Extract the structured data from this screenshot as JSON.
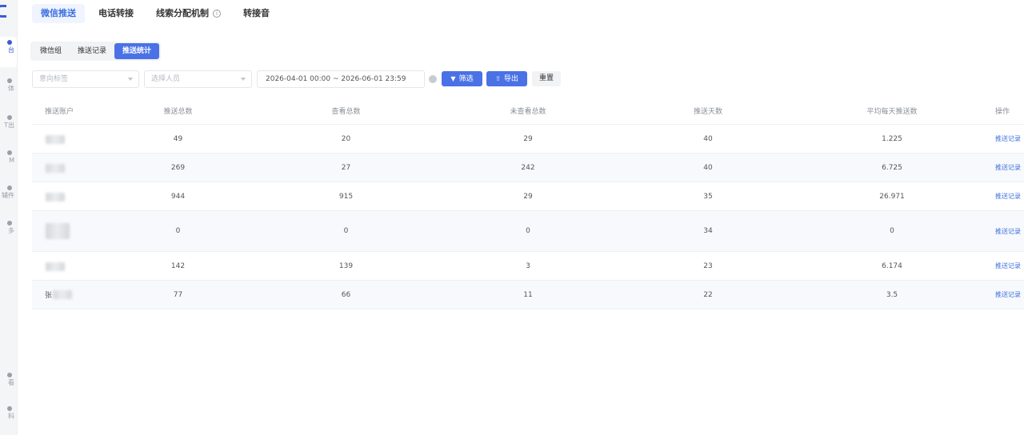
{
  "top_tabs": [
    {
      "label": "微信推送",
      "active": true
    },
    {
      "label": "电话转接",
      "active": false
    },
    {
      "label": "线索分配机制",
      "active": false,
      "has_info": true
    },
    {
      "label": "转接音",
      "active": false
    }
  ],
  "sidebar": {
    "items": [
      {
        "label": "台",
        "active": true
      },
      {
        "label": "体"
      },
      {
        "label": "T出"
      },
      {
        "label": "M"
      },
      {
        "label": "辅件"
      },
      {
        "label": "多"
      },
      {
        "label": "看"
      },
      {
        "label": "科"
      }
    ]
  },
  "sub_tabs": [
    {
      "label": "微信组",
      "active": false
    },
    {
      "label": "推送记录",
      "active": false
    },
    {
      "label": "推送统计",
      "active": true
    }
  ],
  "filters": {
    "intent_tag_placeholder": "意向标签",
    "person_placeholder": "选择人员",
    "date_range": "2026-04-01 00:00 ~ 2026-06-01 23:59",
    "filter_button": "筛选",
    "export_button": "导出",
    "reset_button": "重置"
  },
  "table": {
    "headers": [
      "推送账户",
      "推送总数",
      "查看总数",
      "未查看总数",
      "推送天数",
      "平均每天推送数",
      "操作"
    ],
    "rows": [
      {
        "account": "",
        "push_total": "49",
        "viewed": "20",
        "unviewed": "29",
        "days": "40",
        "avg": "1.225",
        "action": "推送记录"
      },
      {
        "account": "",
        "push_total": "269",
        "viewed": "27",
        "unviewed": "242",
        "days": "40",
        "avg": "6.725",
        "action": "推送记录"
      },
      {
        "account": "",
        "push_total": "944",
        "viewed": "915",
        "unviewed": "29",
        "days": "35",
        "avg": "26.971",
        "action": "推送记录"
      },
      {
        "account": "",
        "push_total": "0",
        "viewed": "0",
        "unviewed": "0",
        "days": "34",
        "avg": "0",
        "action": "推送记录"
      },
      {
        "account": "",
        "push_total": "142",
        "viewed": "139",
        "unviewed": "3",
        "days": "23",
        "avg": "6.174",
        "action": "推送记录"
      },
      {
        "account": "张",
        "push_total": "77",
        "viewed": "66",
        "unviewed": "11",
        "days": "22",
        "avg": "3.5",
        "action": "推送记录"
      }
    ]
  },
  "colors": {
    "accent": "#4a72e6",
    "link": "#3b6fe0"
  }
}
